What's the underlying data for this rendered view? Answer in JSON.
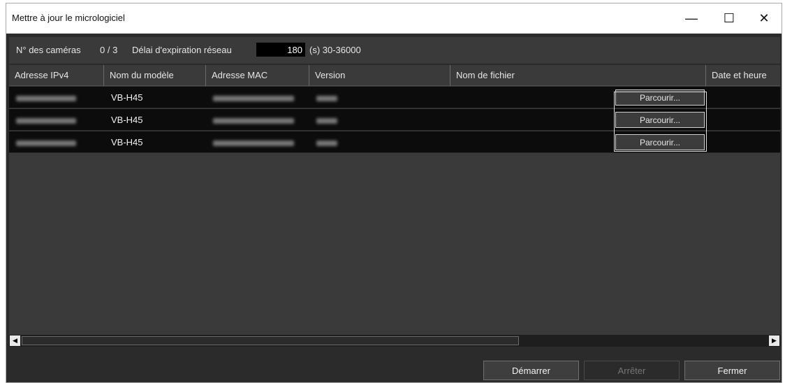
{
  "window": {
    "title": "Mettre à jour le micrologiciel",
    "minimize_glyph": "—",
    "maximize_glyph": "☐",
    "close_glyph": "✕"
  },
  "info": {
    "camera_count_label": "N° des caméras",
    "camera_count_value": "0 / 3",
    "timeout_label": "Délai d'expiration réseau",
    "timeout_value": "180",
    "timeout_range": "(s) 30-36000"
  },
  "table": {
    "columns": [
      "Adresse IPv4",
      "Nom du modèle",
      "Adresse MAC",
      "Version",
      "Nom de fichier",
      "Date et heure"
    ],
    "rows": [
      {
        "model": "VB-H45",
        "browse_label": "Parcourir..."
      },
      {
        "model": "VB-H45",
        "browse_label": "Parcourir..."
      },
      {
        "model": "VB-H45",
        "browse_label": "Parcourir..."
      }
    ]
  },
  "scrollbar": {
    "left_arrow": "◀",
    "right_arrow": "▶"
  },
  "footer": {
    "start_label": "Démarrer",
    "stop_label": "Arrêter",
    "close_label": "Fermer"
  }
}
